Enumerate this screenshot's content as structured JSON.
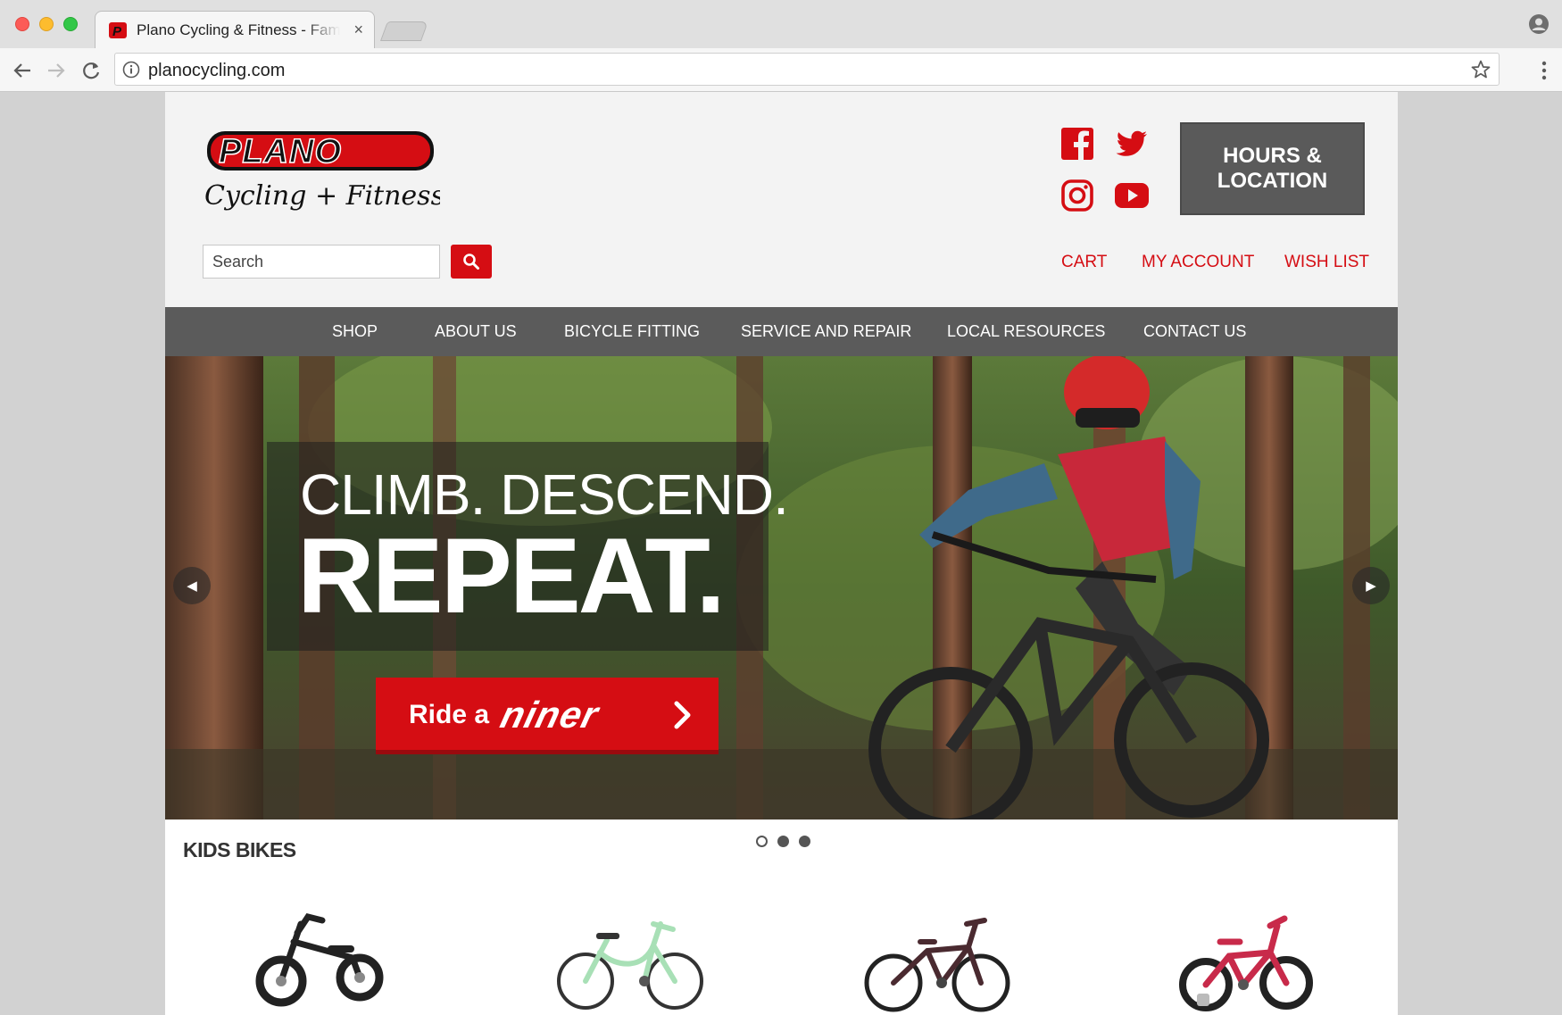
{
  "browser": {
    "tab_title": "Plano Cycling & Fitness - Family Owned Bike Shop",
    "tab_close": "×",
    "url": "planocycling.com"
  },
  "header": {
    "logo_text": "PLANO",
    "logo_tagline": "Cycling + Fitness",
    "search_placeholder": "Search",
    "hours_button": "HOURS & LOCATION",
    "util_links": {
      "cart": "CART",
      "account": "MY ACCOUNT",
      "wish_list": "WISH LIST"
    },
    "social_icons": [
      "facebook-icon",
      "twitter-icon",
      "instagram-icon",
      "youtube-icon"
    ]
  },
  "nav": {
    "items": [
      "SHOP",
      "ABOUT US",
      "BICYCLE FITTING",
      "SERVICE AND REPAIR",
      "LOCAL RESOURCES",
      "CONTACT US"
    ]
  },
  "hero": {
    "headline_line1": "CLIMB. DESCEND.",
    "headline_line2": "REPEAT.",
    "cta_prefix": "Ride a",
    "cta_brand": "niner",
    "prev_arrow": "◀",
    "next_arrow": "▶",
    "slide_count": 3,
    "active_slide": 1
  },
  "section": {
    "title": "KIDS BIKES"
  },
  "products": [
    {
      "name": "balance-bike-black"
    },
    {
      "name": "cruiser-bike-mint"
    },
    {
      "name": "mountain-bike-black"
    },
    {
      "name": "kids-bike-pink"
    }
  ],
  "colors": {
    "brand_red": "#d50d13",
    "nav_gray": "#5b5b5b",
    "hours_gray": "#5a5a5a"
  }
}
